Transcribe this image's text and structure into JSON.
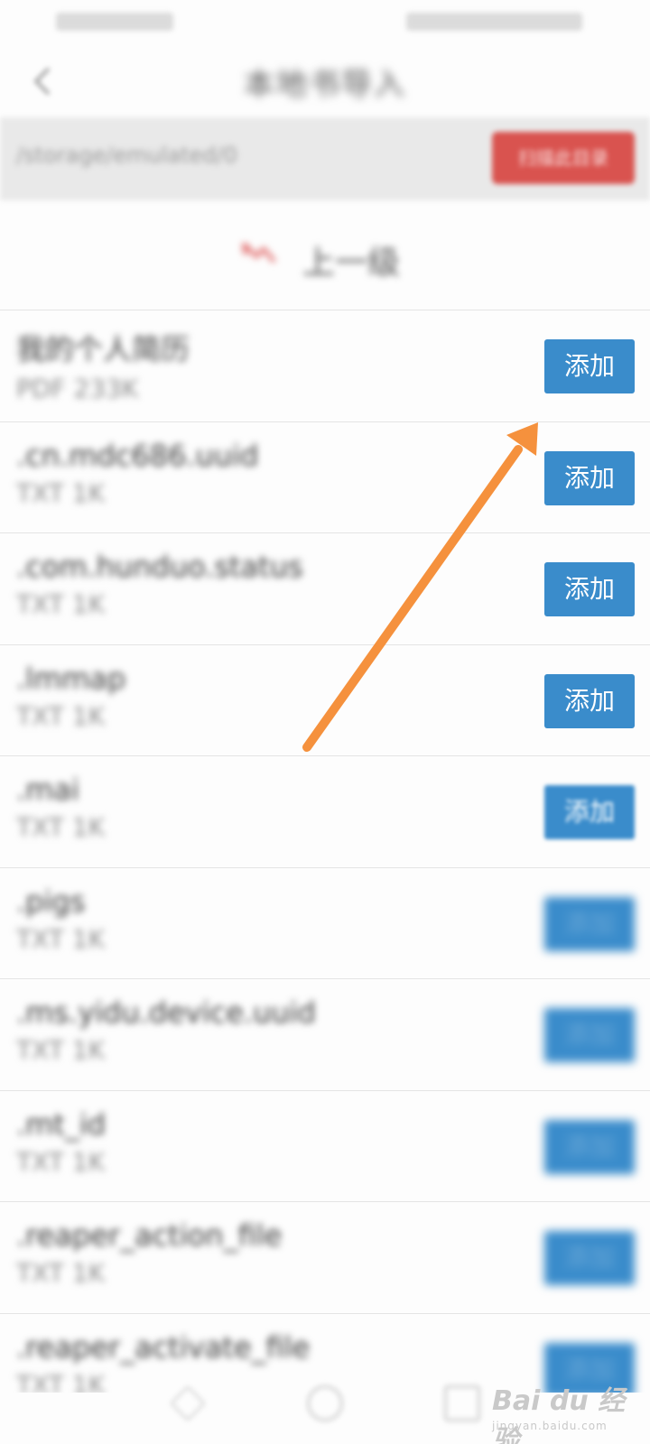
{
  "colors": {
    "accent_blue": "#3a8ccb",
    "accent_red": "#d9534f",
    "annotation_orange": "#f5913d"
  },
  "header": {
    "back_icon": "chevron-left-icon",
    "title": "本地书导入"
  },
  "path_bar": {
    "path": "/storage/emulated/0",
    "button_label": "扫描此目录"
  },
  "up_row": {
    "icon": "return-arrow-icon",
    "label": "上一级"
  },
  "files": [
    {
      "name": "我的个人简历",
      "meta": "PDF  233K",
      "button": "添加"
    },
    {
      "name": ".cn.mdc686.uuid",
      "meta": "TXT  1K",
      "button": "添加"
    },
    {
      "name": ".com.hunduo.status",
      "meta": "TXT  1K",
      "button": "添加"
    },
    {
      "name": ".lmmap",
      "meta": "TXT  1K",
      "button": "添加"
    },
    {
      "name": ".mai",
      "meta": "TXT  1K",
      "button": "添加"
    },
    {
      "name": ".pigs",
      "meta": "TXT  1K",
      "button": "添加"
    },
    {
      "name": ".ms.yidu.device.uuid",
      "meta": "TXT  1K",
      "button": "添加"
    },
    {
      "name": ".mt_id",
      "meta": "TXT  1K",
      "button": "添加"
    },
    {
      "name": ".reaper_action_file",
      "meta": "TXT  1K",
      "button": "添加"
    },
    {
      "name": ".reaper_activate_file",
      "meta": "TXT  1K",
      "button": "添加"
    }
  ],
  "nav_bar": {
    "back_icon": "nav-back-icon",
    "home_icon": "nav-home-icon",
    "recent_icon": "nav-recent-icon"
  },
  "watermark": {
    "brand": "Bai du 经验",
    "url": "jingyan.baidu.com"
  }
}
